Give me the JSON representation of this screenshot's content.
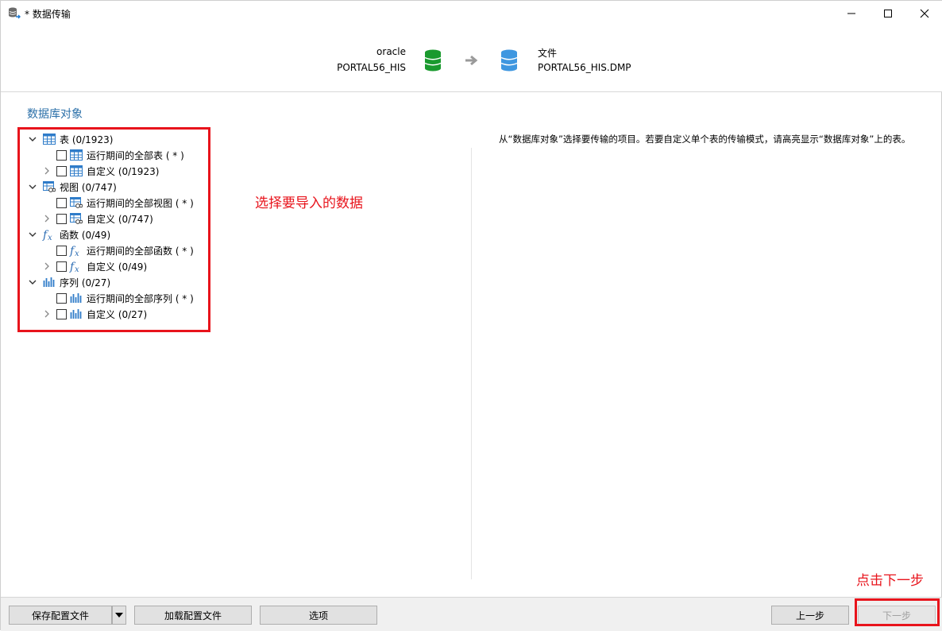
{
  "window": {
    "title": "* 数据传输",
    "accent": "#2a6fa8",
    "annotation_color": "#e8141c"
  },
  "header": {
    "source": {
      "type": "oracle",
      "name": "PORTAL56_HIS",
      "icon": "database-green-icon"
    },
    "arrow_icon": "arrow-right-icon",
    "destination": {
      "type": "文件",
      "name": "PORTAL56_HIS.DMP",
      "icon": "database-blue-icon"
    }
  },
  "section_title": "数据库对象",
  "tree": {
    "groups": [
      {
        "label": "表 (0/1923)",
        "icon": "table-icon",
        "children": [
          {
            "label": "运行期间的全部表 ( * )",
            "icon": "table-icon",
            "checked": false,
            "expandable": false
          },
          {
            "label": "自定义 (0/1923)",
            "icon": "table-icon",
            "checked": false,
            "expandable": true
          }
        ]
      },
      {
        "label": "视图 (0/747)",
        "icon": "view-icon",
        "children": [
          {
            "label": "运行期间的全部视图 ( * )",
            "icon": "view-icon",
            "checked": false,
            "expandable": false
          },
          {
            "label": "自定义 (0/747)",
            "icon": "view-icon",
            "checked": false,
            "expandable": true
          }
        ]
      },
      {
        "label": "函数 (0/49)",
        "icon": "function-icon",
        "children": [
          {
            "label": "运行期间的全部函数 ( * )",
            "icon": "function-icon",
            "checked": false,
            "expandable": false
          },
          {
            "label": "自定义 (0/49)",
            "icon": "function-icon",
            "checked": false,
            "expandable": true
          }
        ]
      },
      {
        "label": "序列 (0/27)",
        "icon": "sequence-icon",
        "children": [
          {
            "label": "运行期间的全部序列 ( * )",
            "icon": "sequence-icon",
            "checked": false,
            "expandable": false
          },
          {
            "label": "自定义 (0/27)",
            "icon": "sequence-icon",
            "checked": false,
            "expandable": true
          }
        ]
      }
    ]
  },
  "hint_text": "从“数据库对象”选择要传输的项目。若要自定义单个表的传输模式，请高亮显示“数据库对象”上的表。",
  "annotations": {
    "select_data": "选择要导入的数据",
    "click_next": "点击下一步"
  },
  "footer": {
    "save_config": "保存配置文件",
    "load_config": "加载配置文件",
    "options": "选项",
    "back": "上一步",
    "next": "下一步"
  }
}
